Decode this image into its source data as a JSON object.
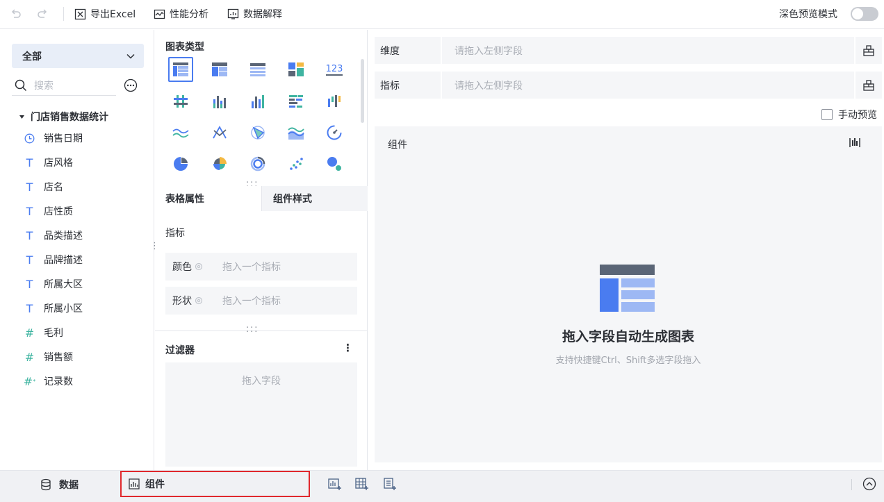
{
  "toolbar": {
    "export_excel": "导出Excel",
    "performance": "性能分析",
    "data_explain": "数据解释",
    "dark_preview": "深色预览模式",
    "dark_preview_on": false
  },
  "left": {
    "scope": "全部",
    "search_placeholder": "搜索",
    "dataset": "门店销售数据统计",
    "fields": [
      {
        "label": "销售日期",
        "type": "date"
      },
      {
        "label": "店风格",
        "type": "text"
      },
      {
        "label": "店名",
        "type": "text"
      },
      {
        "label": "店性质",
        "type": "text"
      },
      {
        "label": "品类描述",
        "type": "text"
      },
      {
        "label": "品牌描述",
        "type": "text"
      },
      {
        "label": "所属大区",
        "type": "text"
      },
      {
        "label": "所属小区",
        "type": "text"
      },
      {
        "label": "毛利",
        "type": "number"
      },
      {
        "label": "销售额",
        "type": "number"
      },
      {
        "label": "记录数",
        "type": "count"
      }
    ]
  },
  "middle": {
    "chart_type_title": "图表类型",
    "chart_types": [
      "table-chart-icon",
      "cross-table-icon",
      "detail-table-icon",
      "combo-table-icon",
      "kpi-number-icon",
      "grouped-bar-icon",
      "stacked-column-icon",
      "column-chart-icon",
      "bar-chart-icon",
      "range-column-icon",
      "line-chart-icon",
      "radar-line-icon",
      "radar-chart-icon",
      "area-chart-icon",
      "gauge-chart-icon",
      "pie-chart-icon",
      "rose-chart-icon",
      "ring-chart-icon",
      "scatter-chart-icon",
      "bubble-chart-icon"
    ],
    "tab_table_props": "表格属性",
    "tab_component_style": "组件样式",
    "measures_label": "指标",
    "color_label": "颜色",
    "color_placeholder": "拖入一个指标",
    "shape_label": "形状",
    "shape_placeholder": "拖入一个指标",
    "filter_title": "过滤器",
    "filter_placeholder": "拖入字段"
  },
  "right": {
    "dimension_label": "维度",
    "dimension_placeholder": "请拖入左侧字段",
    "measure_label": "指标",
    "measure_placeholder": "请拖入左侧字段",
    "manual_preview": "手动预览",
    "manual_preview_checked": false,
    "component_title": "组件",
    "empty_title": "拖入字段自动生成图表",
    "empty_sub": "支持快捷键Ctrl、Shift多选字段拖入"
  },
  "bottom": {
    "data_tab": "数据",
    "component_tab": "组件"
  },
  "colors": {
    "accent": "#4a7cf0",
    "teal": "#3fb4a1",
    "highlight_border": "#e0282d"
  }
}
